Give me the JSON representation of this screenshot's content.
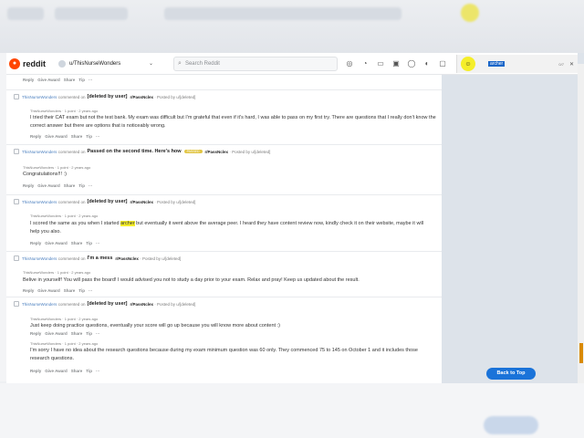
{
  "header": {
    "logo_text": "reddit",
    "community": "u/ThisNurseWonders",
    "search_placeholder": "Search Reddit"
  },
  "find": {
    "query": "archer",
    "count": "0/7"
  },
  "actions": {
    "reply": "Reply",
    "award": "Give Award",
    "share": "Share",
    "tip": "Tip",
    "more": "···"
  },
  "back_to_top": "Back to Top",
  "comments": [
    {
      "user": "ThisNurseWonders",
      "verb": "commented on",
      "post_title": "[deleted by user]",
      "subreddit": "r/PassNclex",
      "posted_by": "· Posted by u/[deleted]",
      "author_line": "ThisNurseWonders · 1 point · 2 years ago",
      "text": "I tried their CAT exam but not the test bank. My exam was difficult but I'm grateful that even if it's hard, I was able to pass on my first try. There are questions that I really don't know the correct answer but there are options that is noticeably wrong."
    },
    {
      "user": "ThisNurseWonders",
      "verb": "commented on",
      "post_title": "Passed on the second time. Here's how",
      "flair": "PASSED",
      "subreddit": "r/PassNclex",
      "posted_by": "· Posted by u/[deleted]",
      "author_line": "ThisNurseWonders · 1 point · 2 years ago",
      "text": "Congratulations!!! :)"
    },
    {
      "user": "ThisNurseWonders",
      "verb": "commented on",
      "post_title": "[deleted by user]",
      "subreddit": "r/PassNclex",
      "posted_by": "· Posted by u/[deleted]",
      "author_line": "ThisNurseWonders · 1 point · 2 years ago",
      "text_before": "I scored the same as you when I started ",
      "text_mark": "archer",
      "text_after": " but eventually it went above the average peer. I heard they have content review now, kindly check it on their website, maybe it will help you also."
    },
    {
      "user": "ThisNurseWonders",
      "verb": "commented on",
      "post_title": "I'm a mess",
      "subreddit": "r/PassNclex",
      "posted_by": "· Posted by u/[deleted]",
      "author_line": "ThisNurseWonders · 1 point · 2 years ago",
      "text": "Belive in yourself! You will pass the board! I would advised you not to study a day prior to your exam. Relax and pray! Keep us updated about the result."
    },
    {
      "user": "ThisNurseWonders",
      "verb": "commented on",
      "post_title": "[deleted by user]",
      "subreddit": "r/PassNclex",
      "posted_by": "· Posted by u/[deleted]",
      "author_line": "ThisNurseWonders · 1 point · 2 years ago",
      "text": "Just keep doing practice questions, eventually your score will go up because you will know more about content :)",
      "author_line_2": "ThisNurseWonders · 1 point · 2 years ago",
      "text_2": "I'm sorry I have no idea about the research questions because during my exam minimum question was 60 only. They commenced 75 to 145 on October 1 and it includes those research questions."
    }
  ]
}
